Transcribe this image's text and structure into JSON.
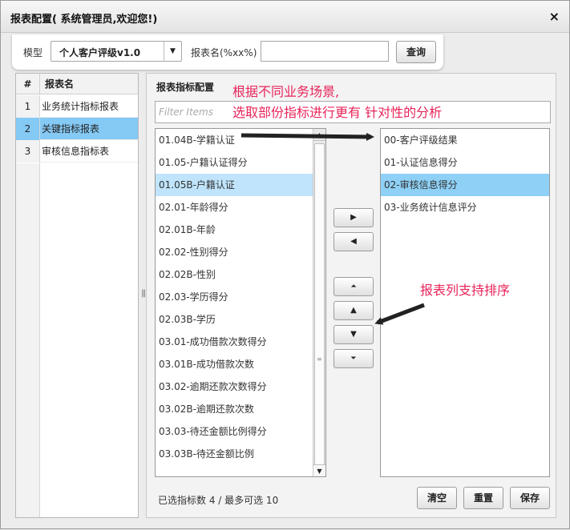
{
  "dialog": {
    "title": "报表配置( 系统管理员,欢迎您!)",
    "close_glyph": "×"
  },
  "toolbar": {
    "model_label": "模型",
    "model_value": "个人客户评级v1.0",
    "report_name_label": "报表名(%xx%)",
    "report_name_value": "",
    "query_label": "查询"
  },
  "report_list": {
    "col_index": "#",
    "col_name": "报表名",
    "rows": [
      {
        "index": "1",
        "name": "业务统计指标报表"
      },
      {
        "index": "2",
        "name": "关键指标报表"
      },
      {
        "index": "3",
        "name": "审核信息指标表"
      }
    ],
    "selected_index": 1
  },
  "config": {
    "title": "报表指标配置",
    "filter_placeholder": "Filter Items",
    "available": [
      "01.04B-学籍认证",
      "01.05-户籍认证得分",
      "01.05B-户籍认证",
      "02.01-年龄得分",
      "02.01B-年龄",
      "02.02-性别得分",
      "02.02B-性别",
      "02.03-学历得分",
      "02.03B-学历",
      "03.01-成功借款次数得分",
      "03.01B-成功借款次数",
      "03.02-逾期还款次数得分",
      "03.02B-逾期还款次数",
      "03.03-待还金额比例得分",
      "03.03B-待还金额比例"
    ],
    "available_selected": 2,
    "selected": [
      "00-客户评级结果",
      "01-认证信息得分",
      "02-审核信息得分",
      "03-业务统计信息评分"
    ],
    "selected_selected": 2,
    "status": "已选指标数 4 / 最多可选 10",
    "buttons": {
      "clear": "清空",
      "reset": "重置",
      "save": "保存"
    },
    "move_icons": {
      "add": "▶",
      "remove": "◀",
      "top": "⏶",
      "up": "▲",
      "down": "▼",
      "bottom": "⏷"
    }
  },
  "annotations": {
    "line1": "根据不同业务场景,",
    "line2": "选取部份指标进行更有 针对性的分析",
    "sort_note": "报表列支持排序",
    "color": "#e8245a"
  }
}
